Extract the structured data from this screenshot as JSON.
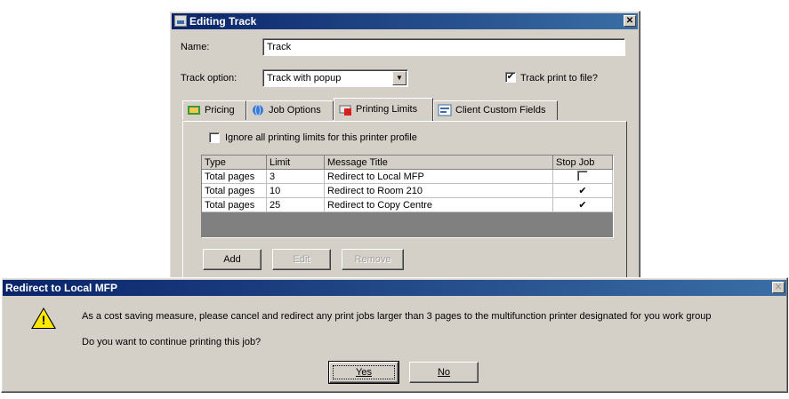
{
  "editing_window": {
    "title": "Editing Track",
    "name_label": "Name:",
    "name_value": "Track",
    "track_option_label": "Track option:",
    "track_option_value": "Track with popup",
    "track_print_label": "Track print to file?",
    "track_print_checked": "✔",
    "tabs": [
      {
        "label": "Pricing",
        "icon": "pricing-icon"
      },
      {
        "label": "Job Options",
        "icon": "globe-icon"
      },
      {
        "label": "Printing Limits",
        "icon": "printer-limit-icon"
      },
      {
        "label": "Client Custom Fields",
        "icon": "form-icon"
      }
    ],
    "ignore_label": "Ignore all printing limits for this printer profile",
    "table": {
      "headers": [
        "Type",
        "Limit",
        "Message Title",
        "Stop Job"
      ],
      "rows": [
        {
          "type": "Total pages",
          "limit": "3",
          "title": "Redirect to Local MFP",
          "stop": ""
        },
        {
          "type": "Total pages",
          "limit": "10",
          "title": "Redirect to Room 210",
          "stop": "✔"
        },
        {
          "type": "Total pages",
          "limit": "25",
          "title": "Redirect to Copy Centre",
          "stop": "✔"
        }
      ]
    },
    "buttons": {
      "add": "Add",
      "edit": "Edit",
      "remove": "Remove"
    }
  },
  "redirect_dialog": {
    "title": "Redirect to Local MFP",
    "message": "As a cost saving measure, please cancel and redirect any print jobs larger than 3 pages to the multifunction printer designated for you work group",
    "question": "Do you want to continue printing this job?",
    "yes_label": "Yes",
    "no_label": "No",
    "warning_mark": "!"
  },
  "colors": {
    "titlebar_start": "#0a246a",
    "titlebar_end": "#3a6ea5",
    "dialog_face": "#d4d0c8",
    "warning_yellow": "#ffe800"
  }
}
